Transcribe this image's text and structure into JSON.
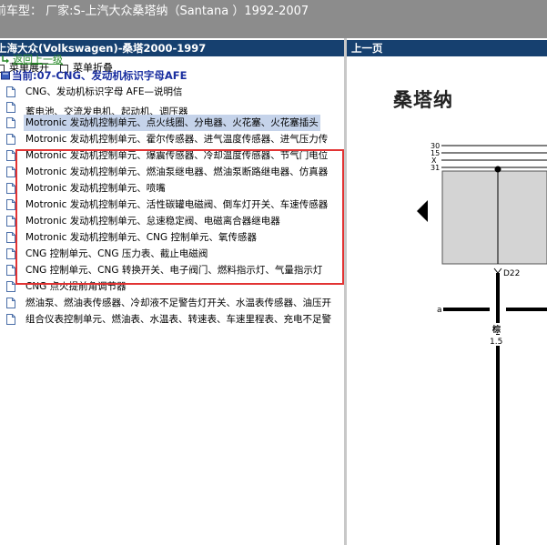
{
  "title_bar": {
    "text": "前车型：  厂家:S-上汽大众桑塔纳（Santana ）1992-2007"
  },
  "left_panel": {
    "header": "上海大众(Volkswagen)-桑塔2000-1997",
    "toolbar": {
      "expand_label": "菜单展开",
      "collapse_label": "菜单折叠"
    },
    "back_label": "返回上一级",
    "current_label": "当前:07-CNG、发动机标识字母AFE",
    "items": [
      {
        "label": "CNG、发动机标识字母 AFE—说明信"
      },
      {
        "label": "蓄电池、交流发电机、起动机、调压器"
      },
      {
        "label": "Motronic 发动机控制单元、点火线圈、分电器、火花塞、火花塞插头"
      },
      {
        "label": "Motronic 发动机控制单元、霍尔传感器、进气温度传感器、进气压力传"
      },
      {
        "label": "Motronic 发动机控制单元、爆震传感器、冷却温度传感器、节气门电位"
      },
      {
        "label": "Motronic 发动机控制单元、燃油泵继电器、燃油泵断路继电器、仿真器"
      },
      {
        "label": "Motronic 发动机控制单元、喷嘴"
      },
      {
        "label": "Motronic 发动机控制单元、活性碳罐电磁阀、倒车灯开关、车速传感器"
      },
      {
        "label": "Motronic 发动机控制单元、怠速稳定阀、电磁离合器继电器"
      },
      {
        "label": "Motronic 发动机控制单元、CNG 控制单元、氧传感器"
      },
      {
        "label": "CNG 控制单元、CNG 压力表、截止电磁阀"
      },
      {
        "label": "CNG 控制单元、CNG 转换开关、电子阀门、燃料指示灯、气量指示灯"
      },
      {
        "label": "CNG 点火提前角调节器"
      },
      {
        "label": "燃油泵、燃油表传感器、冷却液不足警告灯开关、水温表传感器、油压开"
      },
      {
        "label": "组合仪表控制单元、燃油表、水温表、转速表、车速里程表、充电不足警"
      }
    ],
    "selected_index": 2,
    "highlight_color": "#e23333"
  },
  "right_panel": {
    "header": "上一页",
    "diagram_title": "桑塔纳",
    "bus_labels": [
      "30",
      "15",
      "X",
      "31"
    ],
    "connector_label": "D22",
    "wire_terminal_label": "a",
    "wire_color_label": "棕",
    "wire_gauge_label": "1.5"
  },
  "colors": {
    "panel_header_bg": "#16406f",
    "title_bar_bg": "#8c8c8c",
    "selected_bg": "#c5d3ea"
  }
}
